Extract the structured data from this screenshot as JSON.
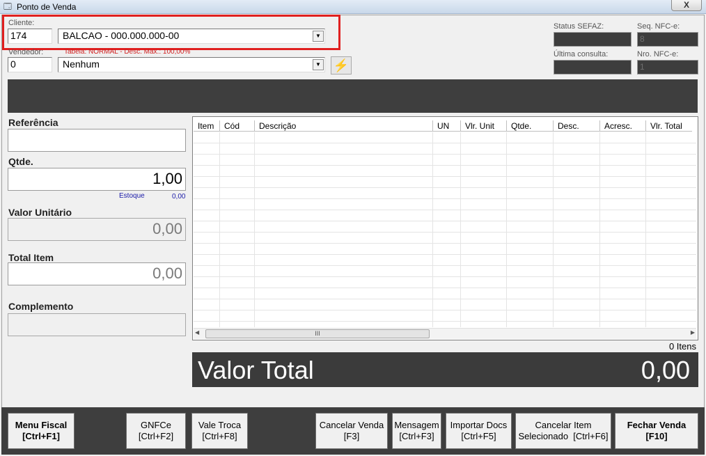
{
  "window": {
    "title": "Ponto de Venda",
    "close": "X"
  },
  "cliente": {
    "label": "Cliente:",
    "code": "174",
    "name": "BALCAO - 000.000.000-00"
  },
  "vendedor": {
    "label": "Vendedor:",
    "tabela": "Tabela: NORMAL - Desc. Max.: 100,00%",
    "code": "0",
    "name": "Nenhum"
  },
  "status": {
    "sefaz_label": "Status SEFAZ:",
    "sefaz_value": "",
    "seq_label": "Seq. NFC-e:",
    "seq_value": "8",
    "ultima_label": "Última consulta:",
    "ultima_value": "",
    "nro_label": "Nro. NFC-e:",
    "nro_value": "1"
  },
  "form": {
    "referencia_label": "Referência",
    "referencia_value": "",
    "qtde_label": "Qtde.",
    "qtde_value": "1,00",
    "estoque_label": "Estoque",
    "estoque_value": "0,00",
    "valor_unitario_label": "Valor Unitário",
    "valor_unitario_value": "0,00",
    "total_item_label": "Total Item",
    "total_item_value": "0,00",
    "complemento_label": "Complemento",
    "complemento_value": ""
  },
  "grid": {
    "columns": [
      "Item",
      "Cód",
      "Descrição",
      "UN",
      "Vlr. Unit",
      "Qtde.",
      "Desc.",
      "Acresc.",
      "Vlr. Total"
    ],
    "rows": [],
    "scroll_grip": "III"
  },
  "itens_count": "0 Itens",
  "valor_total": {
    "label": "Valor Total",
    "value": "0,00"
  },
  "buttons": {
    "menu_fiscal": [
      "Menu Fiscal",
      "[Ctrl+F1]"
    ],
    "gnfce": [
      "GNFCe",
      "[Ctrl+F2]"
    ],
    "vale_troca": [
      "Vale Troca",
      "[Ctrl+F8]"
    ],
    "cancelar_venda": [
      "Cancelar Venda",
      "[F3]"
    ],
    "mensagem": [
      "Mensagem",
      "[Ctrl+F3]"
    ],
    "importar_docs": [
      "Importar Docs",
      "[Ctrl+F5]"
    ],
    "cancelar_item": [
      "Cancelar Item",
      "Selecionado  [Ctrl+F6]"
    ],
    "fechar_venda": [
      "Fechar Venda",
      "[F10]"
    ]
  }
}
